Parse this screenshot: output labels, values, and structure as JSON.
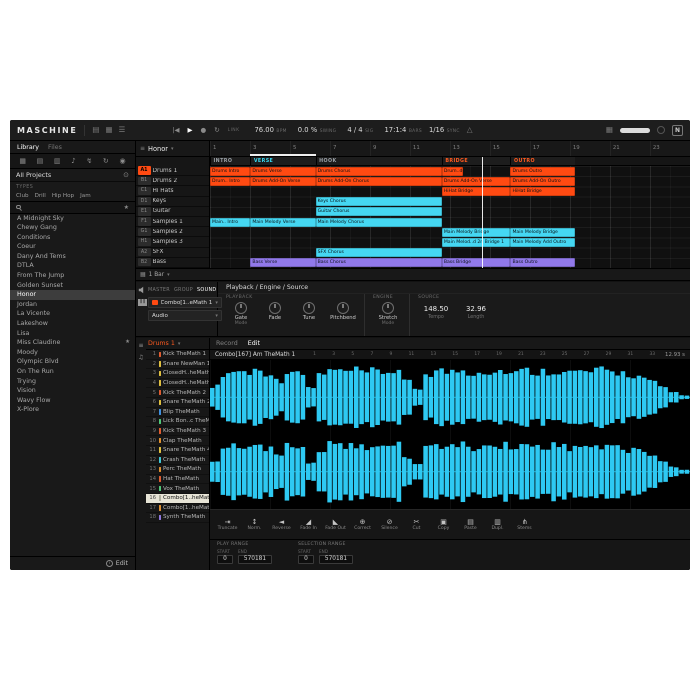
{
  "ui": {
    "chevron": "▾",
    "star": "★",
    "eye": "⊙",
    "song_icon": "≡",
    "grid_icon": "▦",
    "info": "i",
    "rail_events_icon": "≡",
    "rail_keys_icon": "♫"
  },
  "topbar": {
    "logo": "MASCHINE",
    "view_icons": [
      {
        "name": "browser-panel-icon",
        "glyph": "▤"
      },
      {
        "name": "ideas-view-icon",
        "glyph": "▦"
      },
      {
        "name": "mixer-view-icon",
        "glyph": "☰"
      }
    ],
    "transport": {
      "restart_glyph": "|◀",
      "play_glyph": "▶",
      "record_glyph": "●",
      "loop_glyph": "↻",
      "link_label": "LINK"
    },
    "metrics": [
      {
        "value": "76.00",
        "unit": "BPM"
      },
      {
        "value": "0.0 %",
        "unit": "SWING"
      },
      {
        "value": "4 / 4",
        "unit": "SIG"
      },
      {
        "value": "17:1:4",
        "unit": "BARS"
      }
    ],
    "sync_value": "1/16",
    "sync_label": "SYNC",
    "metronome_glyph": "△",
    "keyboard_glyph": "▦",
    "ni_label": "N"
  },
  "browser": {
    "tabs": [
      {
        "label": "Library",
        "active": true
      },
      {
        "label": "Files",
        "active": false
      }
    ],
    "filter_icons": [
      {
        "name": "projects-filter-icon",
        "glyph": "▦"
      },
      {
        "name": "groups-filter-icon",
        "glyph": "▤"
      },
      {
        "name": "sounds-filter-icon",
        "glyph": "▥"
      },
      {
        "name": "instruments-filter-icon",
        "glyph": "♪"
      },
      {
        "name": "effects-filter-icon",
        "glyph": "↯"
      },
      {
        "name": "loops-filter-icon",
        "glyph": "↻"
      },
      {
        "name": "user-filter-icon",
        "glyph": "◉"
      }
    ],
    "section_title": "All Projects",
    "types_label": "TYPES",
    "type_tags": [
      "Club",
      "Drill",
      "Hip Hop",
      "Jam"
    ],
    "search_value": "",
    "projects": [
      {
        "label": "A Midnight Sky"
      },
      {
        "label": "Chewy Gang"
      },
      {
        "label": "Conditions"
      },
      {
        "label": "Coeur"
      },
      {
        "label": "Dany And Tems"
      },
      {
        "label": "DTLA"
      },
      {
        "label": "From The Jump"
      },
      {
        "label": "Golden Sunset"
      },
      {
        "label": "Honor",
        "selected": true
      },
      {
        "label": "Jordan"
      },
      {
        "label": "La Vicente"
      },
      {
        "label": "Lakeshow"
      },
      {
        "label": "Lisa"
      },
      {
        "label": "Miss Claudine",
        "starred": true
      },
      {
        "label": "Moody"
      },
      {
        "label": "Olympic Blvd"
      },
      {
        "label": "On The Run"
      },
      {
        "label": "Trying"
      },
      {
        "label": "Vision"
      },
      {
        "label": "Wavy Flow"
      },
      {
        "label": "X-Plore"
      }
    ],
    "edit_label": "Edit"
  },
  "arranger": {
    "title": "Honor",
    "ruler_ticks": [
      "1",
      "3",
      "5",
      "7",
      "9",
      "11",
      "13",
      "15",
      "17",
      "19",
      "21",
      "23"
    ],
    "loop": {
      "start": 8.4,
      "end": 22
    },
    "playhead": 56.7,
    "sections": [
      {
        "label": "INTRO",
        "start": 0,
        "end": 8.4,
        "color": "#9aa0a6"
      },
      {
        "label": "VERSE",
        "start": 8.4,
        "end": 22,
        "color": "#38d9f2"
      },
      {
        "label": "HOOK",
        "start": 22,
        "end": 48.3,
        "color": "#9aa0a6"
      },
      {
        "label": "BRIDGE",
        "start": 48.3,
        "end": 62.6,
        "color": "#ff5a1f"
      },
      {
        "label": "OUTRO",
        "start": 62.6,
        "end": 76,
        "color": "#ff5a1f"
      }
    ],
    "tracks": [
      {
        "slot": "A1",
        "name": "Drums 1",
        "selected": true
      },
      {
        "slot": "B1",
        "name": "Drums 2"
      },
      {
        "slot": "C1",
        "name": "Hi Hats"
      },
      {
        "slot": "D1",
        "name": "Keys"
      },
      {
        "slot": "E1",
        "name": "Guitar"
      },
      {
        "slot": "F1",
        "name": "Samples 1"
      },
      {
        "slot": "G1",
        "name": "Samples 2"
      },
      {
        "slot": "H1",
        "name": "Samples 3"
      },
      {
        "slot": "A2",
        "name": "SFX"
      },
      {
        "slot": "B2",
        "name": "Bass"
      }
    ],
    "clips": [
      {
        "row": 0,
        "start": 0,
        "end": 8.4,
        "label": "Drums Intro",
        "color": "#ff4a12"
      },
      {
        "row": 0,
        "start": 8.4,
        "end": 22,
        "label": "Drums Verse",
        "color": "#ff4a12"
      },
      {
        "row": 0,
        "start": 22,
        "end": 48.3,
        "label": "Drums Chorus",
        "color": "#ff4a12"
      },
      {
        "row": 0,
        "start": 48.3,
        "end": 52.8,
        "label": "Drum..dge 1",
        "color": "#ff4a12"
      },
      {
        "row": 0,
        "start": 62.6,
        "end": 76,
        "label": "Drums Outro",
        "color": "#ff4a12"
      },
      {
        "row": 1,
        "start": 0,
        "end": 8.4,
        "label": "Drum.. Intro",
        "color": "#ff4a12"
      },
      {
        "row": 1,
        "start": 8.4,
        "end": 22,
        "label": "Drums Add-On Verse",
        "color": "#ff4a12"
      },
      {
        "row": 1,
        "start": 22,
        "end": 48.3,
        "label": "Drums Add-On Chorus",
        "color": "#ff4a12"
      },
      {
        "row": 1,
        "start": 48.3,
        "end": 62.6,
        "label": "Drums Add-On Verse",
        "color": "#ff4a12"
      },
      {
        "row": 1,
        "start": 62.6,
        "end": 76,
        "label": "Drums Add-On Outro",
        "color": "#ff4a12"
      },
      {
        "row": 2,
        "start": 48.3,
        "end": 62.6,
        "label": "HiHat Bridge",
        "color": "#ff4a12"
      },
      {
        "row": 2,
        "start": 62.6,
        "end": 76,
        "label": "HiHat Bridge",
        "color": "#ff4a12"
      },
      {
        "row": 3,
        "start": 22,
        "end": 48.3,
        "label": "Keys Chorus",
        "color": "#45d7f2"
      },
      {
        "row": 4,
        "start": 22,
        "end": 48.3,
        "label": "Guitar Chorus",
        "color": "#45d7f2"
      },
      {
        "row": 5,
        "start": 0,
        "end": 8.4,
        "label": "Main.. Intro",
        "color": "#45d7f2"
      },
      {
        "row": 5,
        "start": 8.4,
        "end": 22,
        "label": "Main Melody Verse",
        "color": "#45d7f2"
      },
      {
        "row": 5,
        "start": 22,
        "end": 48.3,
        "label": "Main Melody Chorus",
        "color": "#45d7f2"
      },
      {
        "row": 6,
        "start": 48.3,
        "end": 62.6,
        "label": "Main Melody Bridge",
        "color": "#45d7f2"
      },
      {
        "row": 6,
        "start": 62.6,
        "end": 76,
        "label": "Main Melody Bridge",
        "color": "#45d7f2"
      },
      {
        "row": 7,
        "start": 48.3,
        "end": 62.6,
        "label": "Main Melod..d 2n Bridge 1",
        "color": "#45d7f2"
      },
      {
        "row": 7,
        "start": 62.6,
        "end": 76,
        "label": "Main Melody Add Outro",
        "color": "#45d7f2"
      },
      {
        "row": 8,
        "start": 22,
        "end": 48.3,
        "label": "SFX Chorus",
        "color": "#45d7f2"
      },
      {
        "row": 9,
        "start": 8.4,
        "end": 22,
        "label": "Bass Verse",
        "color": "#9179ea"
      },
      {
        "row": 9,
        "start": 22,
        "end": 48.3,
        "label": "Bass Chorus",
        "color": "#9179ea"
      },
      {
        "row": 9,
        "start": 48.3,
        "end": 62.6,
        "label": "Bass Bridge",
        "color": "#9179ea"
      },
      {
        "row": 9,
        "start": 62.6,
        "end": 76,
        "label": "Bass Outro",
        "color": "#9179ea"
      }
    ],
    "grid_label": "1 Bar"
  },
  "channel": {
    "tabs": [
      {
        "label": "MASTER"
      },
      {
        "label": "GROUP"
      },
      {
        "label": "SOUND",
        "active": true
      }
    ],
    "sound_name": "Combo[1..eMath 1",
    "io_value": "Audio",
    "panel_title": "Playback / Engine / Source",
    "playback_label": "PLAYBACK",
    "engine_label": "ENGINE",
    "source_label": "SOURCE",
    "playback_knobs": [
      {
        "label": "Gate",
        "sub": "Mode"
      },
      {
        "label": "Fade"
      },
      {
        "label": "Tune"
      },
      {
        "label": "Pitchbend"
      }
    ],
    "engine_knob": {
      "label": "Stretch",
      "sub": "Mode"
    },
    "tempo_value": "148.50",
    "tempo_label": "Tempo",
    "length_value": "32.96",
    "length_label": "Length"
  },
  "sampler": {
    "group_name": "Drums 1",
    "pads": [
      {
        "num": "1",
        "name": "Kick TheMath 1",
        "color": "#e05c30"
      },
      {
        "num": "2",
        "name": "Snare NewMan 1",
        "color": "#e0c040"
      },
      {
        "num": "3",
        "name": "ClosedH..heMath 1",
        "color": "#e0c040"
      },
      {
        "num": "4",
        "name": "ClosedH..heMath 2",
        "color": "#e0c040"
      },
      {
        "num": "5",
        "name": "Kick TheMath 2",
        "color": "#e05c30"
      },
      {
        "num": "6",
        "name": "Snare TheMath 2",
        "color": "#e0c040"
      },
      {
        "num": "7",
        "name": "Blip TheMath",
        "color": "#4090e0"
      },
      {
        "num": "8",
        "name": "Lick Bon..c TheMath",
        "color": "#50c878"
      },
      {
        "num": "9",
        "name": "Kick TheMath 3",
        "color": "#e05c30"
      },
      {
        "num": "10",
        "name": "Clap TheMath",
        "color": "#e09030"
      },
      {
        "num": "11",
        "name": "Snare TheMath 4",
        "color": "#e0c040"
      },
      {
        "num": "12",
        "name": "Crash TheMath",
        "color": "#40c8d8"
      },
      {
        "num": "13",
        "name": "Perc TheMath",
        "color": "#e09030"
      },
      {
        "num": "14",
        "name": "Hat TheMath",
        "color": "#e05c30"
      },
      {
        "num": "15",
        "name": "Vox TheMath",
        "color": "#50c878"
      },
      {
        "num": "16",
        "name": "Combo[1..heMath 1",
        "color": "#b0ae9e",
        "selected": true
      },
      {
        "num": "17",
        "name": "Combo[1..heMath 2",
        "color": "#e09030"
      },
      {
        "num": "18",
        "name": "Synth TheMath",
        "color": "#9078e0"
      }
    ],
    "tabs": [
      {
        "label": "Record"
      },
      {
        "label": "Edit",
        "active": true
      }
    ],
    "sample_name": "Combo[167] Am TheMath 1",
    "duration": "12.93 s",
    "ruler_ticks": [
      "1",
      "3",
      "5",
      "7",
      "9",
      "11",
      "13",
      "15",
      "17",
      "19",
      "21",
      "23",
      "25",
      "27",
      "29",
      "31",
      "33"
    ],
    "waveform": {
      "color": "#2ec9f2",
      "amplitudes": [
        0.4,
        0.85,
        0.95,
        0.9,
        0.97,
        0.88,
        0.6,
        0.93,
        0.82,
        0.35,
        0.8,
        0.96,
        0.9,
        0.95,
        0.87,
        0.93,
        0.9,
        0.96,
        0.55,
        0.3,
        0.85,
        0.95,
        0.9,
        0.96,
        0.88,
        0.94,
        0.9,
        0.95,
        0.86,
        0.96,
        0.9,
        0.93,
        0.95,
        0.88,
        0.92,
        0.9,
        0.96,
        0.9,
        0.88,
        0.8,
        0.72,
        0.55,
        0.35,
        0.18,
        0.07
      ]
    },
    "toolbar": [
      {
        "label": "Truncate",
        "glyph": "⇥",
        "name": "truncate-button"
      },
      {
        "label": "Norm.",
        "glyph": "↕",
        "name": "normalize-button"
      },
      {
        "label": "Reverse",
        "glyph": "◄",
        "name": "reverse-button"
      },
      {
        "label": "Fade In",
        "glyph": "◢",
        "name": "fade-in-button"
      },
      {
        "label": "Fade Out",
        "glyph": "◣",
        "name": "fade-out-button"
      },
      {
        "label": "Correct",
        "glyph": "⊕",
        "name": "correct-button"
      },
      {
        "label": "Silence",
        "glyph": "⊘",
        "name": "silence-button"
      },
      {
        "label": "Cut",
        "glyph": "✂",
        "name": "cut-button"
      },
      {
        "label": "Copy",
        "glyph": "▣",
        "name": "copy-button"
      },
      {
        "label": "Paste",
        "glyph": "▤",
        "name": "paste-button"
      },
      {
        "label": "Dupl.",
        "glyph": "▥",
        "name": "duplicate-button"
      },
      {
        "label": "Stems",
        "glyph": "⋔",
        "name": "stems-button"
      }
    ],
    "play_range": {
      "label": "PLAY RANGE",
      "start_label": "START",
      "start_value": "0",
      "end_label": "END",
      "end_value": "570181"
    },
    "selection_range": {
      "label": "SELECTION RANGE",
      "start_label": "START",
      "start_value": "0",
      "end_label": "END",
      "end_value": "570181"
    }
  }
}
